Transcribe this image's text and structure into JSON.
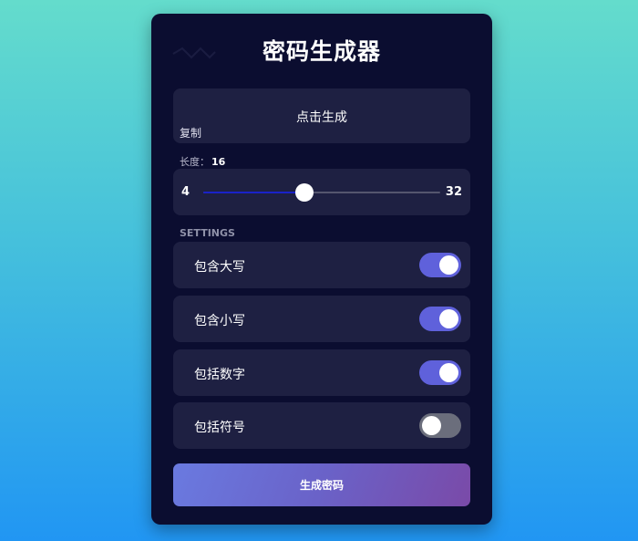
{
  "app": {
    "title": "密码生成器"
  },
  "password_display": {
    "placeholder_text": "点击生成",
    "copy_label": "复制"
  },
  "length": {
    "label": "长度：",
    "value": 16,
    "value_text": "16",
    "min": 4,
    "min_text": "4",
    "max": 32,
    "max_text": "32"
  },
  "settings": {
    "heading": "SETTINGS",
    "options": [
      {
        "label": "包含大写",
        "enabled": true
      },
      {
        "label": "包含小写",
        "enabled": true
      },
      {
        "label": "包括数字",
        "enabled": true
      },
      {
        "label": "包括符号",
        "enabled": false
      }
    ]
  },
  "generate_button": {
    "label": "生成密码"
  },
  "colors": {
    "accent": "#5f61db",
    "toggle_off": "#6b6e7c",
    "card_bg": "#0b0d30",
    "panel_bg": "#1e2042",
    "slider_fill": "#1a22c8"
  }
}
